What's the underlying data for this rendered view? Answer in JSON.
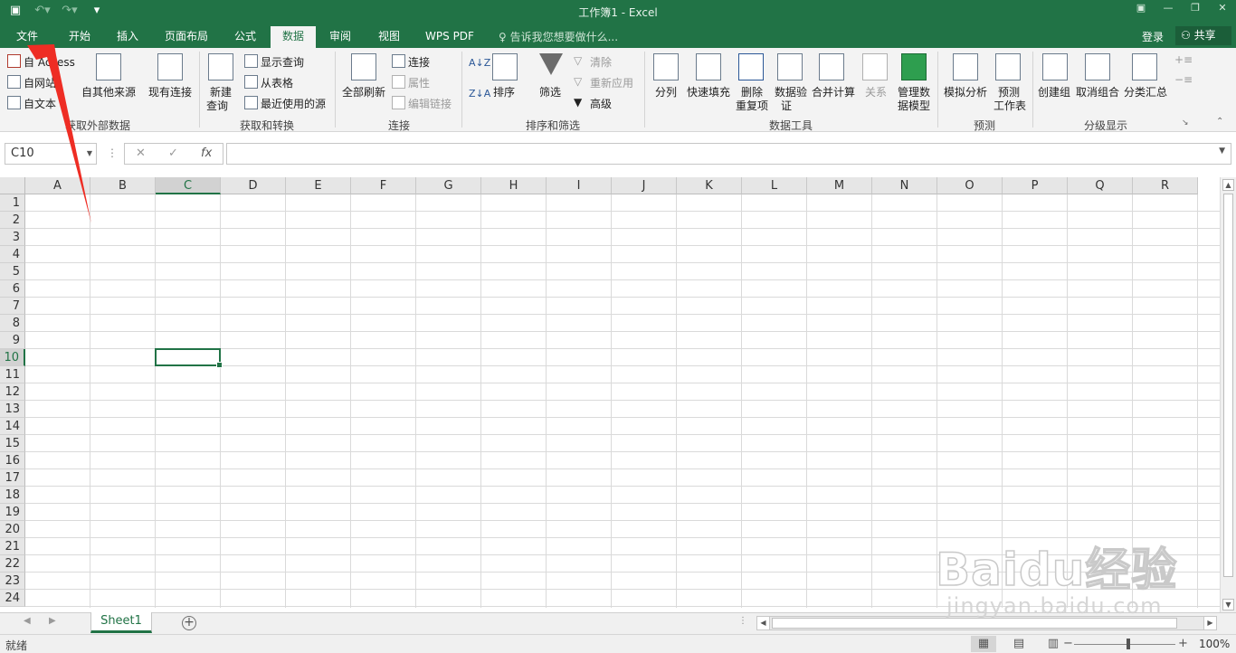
{
  "titlebar": {
    "title": "工作簿1 - Excel",
    "qat_save_icon": "save-icon",
    "qat_undo_icon": "undo-icon",
    "qat_redo_icon": "redo-icon",
    "qat_customize_icon": "customize-qat-icon",
    "win_ribbon_options_icon": "ribbon-display-options-icon",
    "win_minimize_icon": "minimize-icon",
    "win_restore_icon": "restore-icon",
    "win_close_icon": "close-icon"
  },
  "tabs": [
    {
      "label": "文件"
    },
    {
      "label": "开始"
    },
    {
      "label": "插入"
    },
    {
      "label": "页面布局"
    },
    {
      "label": "公式"
    },
    {
      "label": "数据"
    },
    {
      "label": "审阅"
    },
    {
      "label": "视图"
    },
    {
      "label": "WPS PDF"
    }
  ],
  "active_tab": "数据",
  "tell_me": "告诉我您想要做什么...",
  "account": {
    "login": "登录",
    "share": "共享"
  },
  "ribbon": {
    "get_external": {
      "access": "自 Access",
      "web": "自网站",
      "text": "自文本",
      "other_sources": "自其他来源",
      "existing": "现有连接",
      "group": "获取外部数据"
    },
    "get_transform": {
      "new_query_1": "新建",
      "new_query_2": "查询",
      "show_queries": "显示查询",
      "from_table": "从表格",
      "recent_sources": "最近使用的源",
      "group": "获取和转换"
    },
    "connections": {
      "refresh_all": "全部刷新",
      "connections": "连接",
      "properties": "属性",
      "edit_links": "编辑链接",
      "group": "连接"
    },
    "sort_filter": {
      "sort": "排序",
      "filter": "筛选",
      "clear": "清除",
      "reapply": "重新应用",
      "advanced": "高级",
      "group": "排序和筛选"
    },
    "data_tools": {
      "text_to_columns": "分列",
      "flash_fill": "快速填充",
      "remove_dup_1": "删除",
      "remove_dup_2": "重复项",
      "validation_1": "数据验",
      "validation_2": "证",
      "consolidate": "合并计算",
      "relationships": "关系",
      "manage_model_1": "管理数",
      "manage_model_2": "据模型",
      "group": "数据工具"
    },
    "forecast": {
      "what_if": "模拟分析",
      "forecast_sheet_1": "预测",
      "forecast_sheet_2": "工作表",
      "group": "预测"
    },
    "outline": {
      "group_btn": "创建组",
      "ungroup": "取消组合",
      "subtotal": "分类汇总",
      "group": "分级显示"
    }
  },
  "formula_bar": {
    "name_box": "C10",
    "cancel": "✕",
    "enter": "✓",
    "fx": "fx",
    "value": ""
  },
  "columns": [
    "A",
    "B",
    "C",
    "D",
    "E",
    "F",
    "G",
    "H",
    "I",
    "J",
    "K",
    "L",
    "M",
    "N",
    "O",
    "P",
    "Q",
    "R"
  ],
  "rows": [
    "1",
    "2",
    "3",
    "4",
    "5",
    "6",
    "7",
    "8",
    "9",
    "10",
    "11",
    "12",
    "13",
    "14",
    "15",
    "16",
    "17",
    "18",
    "19",
    "20",
    "21",
    "22",
    "23",
    "24"
  ],
  "selected_cell": {
    "col": "C",
    "row": 10
  },
  "sheets": [
    {
      "name": "Sheet1"
    }
  ],
  "status": {
    "ready": "就绪",
    "zoom": "100%"
  },
  "watermark": {
    "logo": "Baidu经验",
    "url": "jingyan.baidu.com"
  },
  "annotation_color": "#ee2d24",
  "accent": "#217346"
}
